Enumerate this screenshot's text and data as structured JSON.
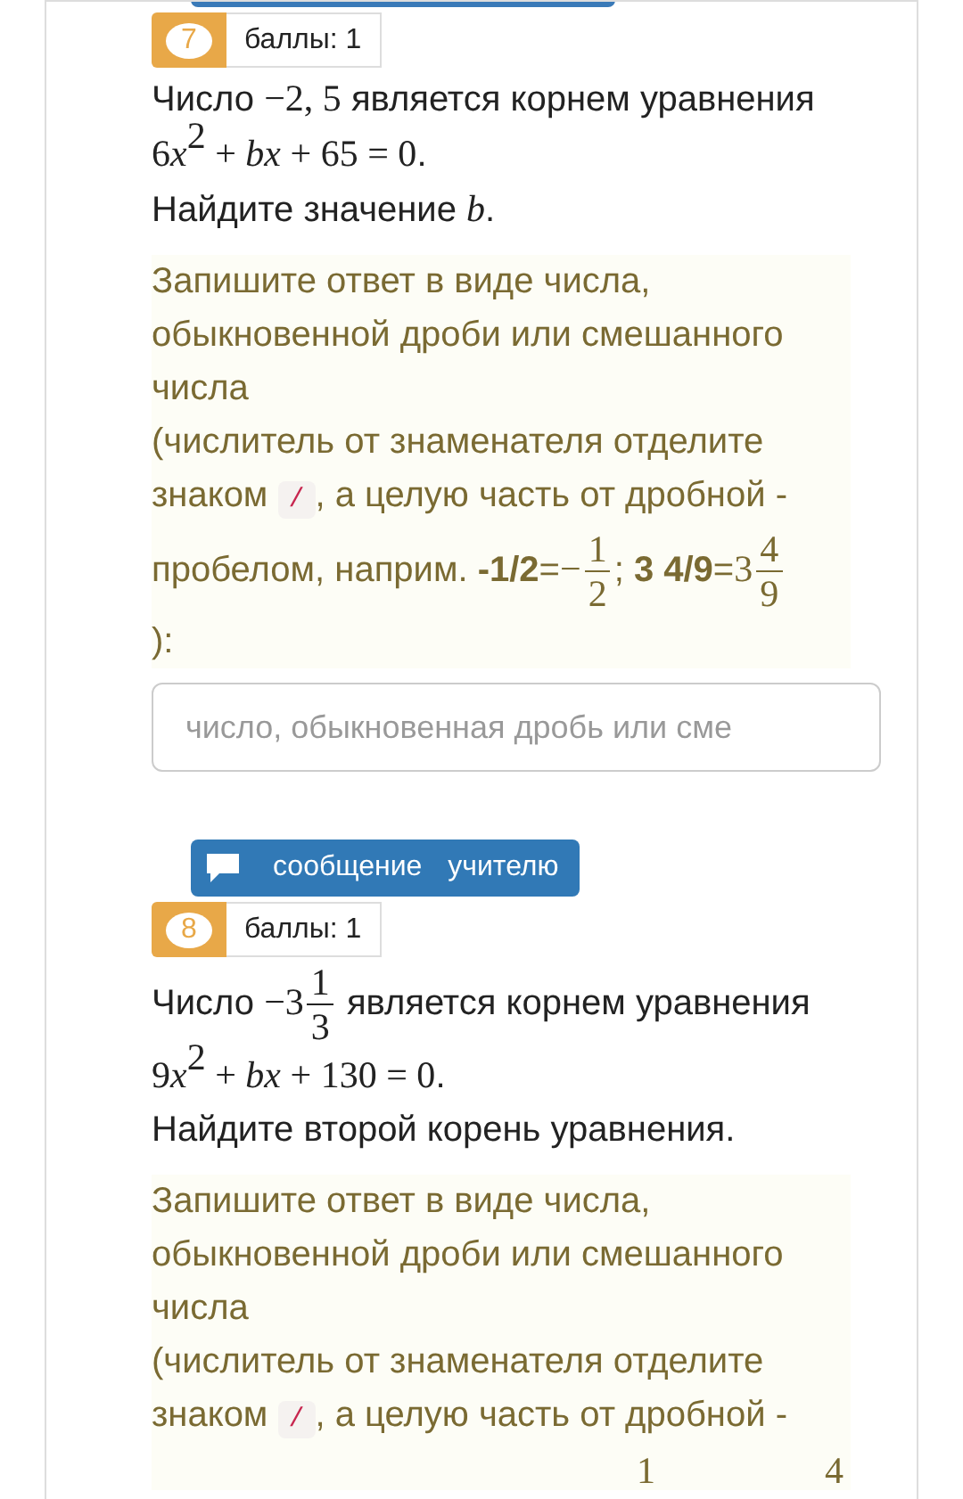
{
  "tasks": [
    {
      "message_button": {
        "cut": true
      },
      "number": "7",
      "points": "баллы: 1",
      "statement": [
        {
          "kind": "text",
          "text": "Число "
        },
        {
          "kind": "math",
          "text": "−2, 5"
        },
        {
          "kind": "text",
          "text": " является корнем уравнения "
        },
        {
          "kind": "math",
          "text": "6"
        },
        {
          "kind": "var",
          "text": "x"
        },
        {
          "kind": "sup",
          "text": "2"
        },
        {
          "kind": "math",
          "text": " + "
        },
        {
          "kind": "var",
          "text": "bx"
        },
        {
          "kind": "math",
          "text": " + 65 = 0"
        },
        {
          "kind": "text",
          "text": "."
        },
        {
          "kind": "br"
        },
        {
          "kind": "text",
          "text": "Найдите значение "
        },
        {
          "kind": "var",
          "text": "b"
        },
        {
          "kind": "text",
          "text": "."
        }
      ],
      "hint": [
        {
          "kind": "text",
          "text": "Запишите ответ в виде числа, обыкновенной дроби или смешанного числа"
        },
        {
          "kind": "br"
        },
        {
          "kind": "text",
          "text": "(числитель от знаменателя отделите знаком "
        },
        {
          "kind": "code",
          "text": "/"
        },
        {
          "kind": "text",
          "text": ", а целую часть от дробной - пробелом, наприм. "
        },
        {
          "kind": "bold",
          "text": "-1/2"
        },
        {
          "kind": "text",
          "text": "="
        },
        {
          "kind": "frac",
          "whole": "−",
          "num": "1",
          "den": "2"
        },
        {
          "kind": "text",
          "text": "; "
        },
        {
          "kind": "bold",
          "text": "3 4/9"
        },
        {
          "kind": "text",
          "text": "="
        },
        {
          "kind": "frac",
          "whole": "3",
          "num": "4",
          "den": "9"
        },
        {
          "kind": "br"
        },
        {
          "kind": "text",
          "text": "):"
        }
      ],
      "answer": {
        "placeholder": "число, обыкновенная дробь или сме"
      }
    },
    {
      "message_button": {
        "cut": false,
        "label": "сообщение учителю"
      },
      "number": "8",
      "points": "баллы: 1",
      "statement": [
        {
          "kind": "text",
          "text": "Число "
        },
        {
          "kind": "frac",
          "whole": "−3",
          "num": "1",
          "den": "3"
        },
        {
          "kind": "text",
          "text": " является корнем уравнения "
        },
        {
          "kind": "math",
          "text": "9"
        },
        {
          "kind": "var",
          "text": "x"
        },
        {
          "kind": "sup",
          "text": "2"
        },
        {
          "kind": "math",
          "text": " + "
        },
        {
          "kind": "var",
          "text": "bx"
        },
        {
          "kind": "math",
          "text": " + 130 = 0"
        },
        {
          "kind": "text",
          "text": "."
        },
        {
          "kind": "br"
        },
        {
          "kind": "text",
          "text": "Найдите второй корень уравнения."
        }
      ],
      "hint": [
        {
          "kind": "text",
          "text": "Запишите ответ в виде числа, обыкновенной дроби или смешанного числа"
        },
        {
          "kind": "br"
        },
        {
          "kind": "text",
          "text": "(числитель от знаменателя отделите знаком "
        },
        {
          "kind": "code",
          "text": "/"
        },
        {
          "kind": "text",
          "text": ", а целую часть от дробной -"
        },
        {
          "kind": "cutnums",
          "nums": [
            "1",
            "4"
          ]
        }
      ]
    }
  ]
}
